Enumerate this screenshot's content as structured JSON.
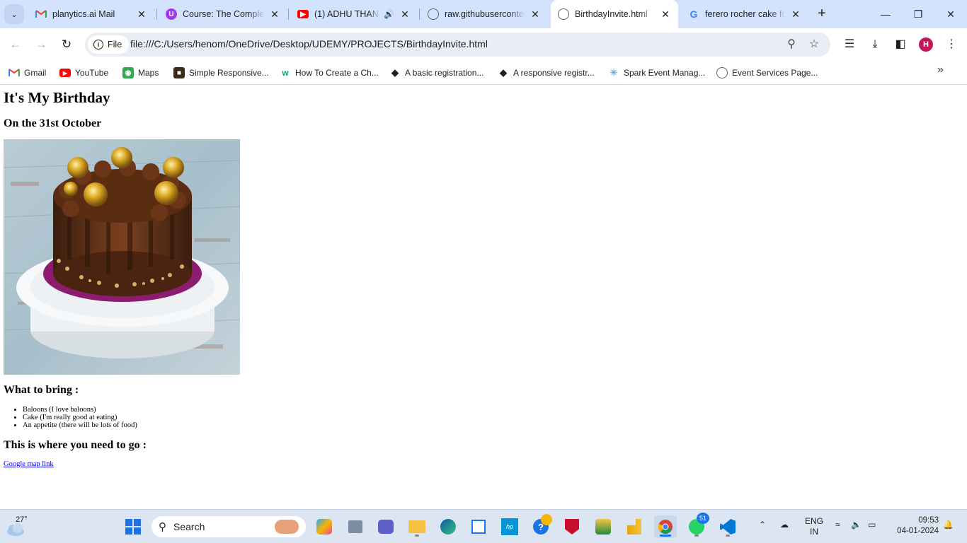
{
  "browser": {
    "tabs": [
      {
        "title": "planytics.ai Mail",
        "icon": "gmail-icon",
        "color": "#ea4335"
      },
      {
        "title": "Course: The Complete",
        "icon": "udemy-icon",
        "color": "#a435f0"
      },
      {
        "title": "(1) ADHU THAN K",
        "icon": "youtube-icon",
        "color": "#ff0000"
      },
      {
        "title": "raw.githubuserconten",
        "icon": "globe-icon",
        "color": "#5f6368"
      },
      {
        "title": "BirthdayInvite.html",
        "icon": "globe-icon",
        "color": "#5f6368"
      },
      {
        "title": "ferero rocher cake fo",
        "icon": "google-icon",
        "color": "#4285f4"
      }
    ],
    "active_tab_index": 4,
    "address": {
      "chip_label": "File",
      "url": "file:///C:/Users/henom/OneDrive/Desktop/UDEMY/PROJECTS/BirthdayInvite.html"
    },
    "profile_initial": "H",
    "bookmarks": [
      {
        "label": "Gmail",
        "icon": "gmail-icon"
      },
      {
        "label": "YouTube",
        "icon": "youtube-icon"
      },
      {
        "label": "Maps",
        "icon": "maps-icon"
      },
      {
        "label": "Simple Responsive...",
        "icon": "site-icon"
      },
      {
        "label": "How To Create a Ch...",
        "icon": "w3schools-icon"
      },
      {
        "label": "A basic registration...",
        "icon": "codepen-icon"
      },
      {
        "label": "A responsive registr...",
        "icon": "codepen-icon"
      },
      {
        "label": "Spark Event Manag...",
        "icon": "spark-icon"
      },
      {
        "label": "Event Services Page...",
        "icon": "globe-icon"
      }
    ]
  },
  "page": {
    "title": "It's My Birthday",
    "date": "On the 31st October",
    "bring_heading": "What to bring :",
    "bring_items": [
      "Baloons (I love baloons)",
      "Cake (I'm really good at eating)",
      "An appetite (there will be lots of food)"
    ],
    "go_heading": "This is where you need to go :",
    "map_link": "Google map link"
  },
  "taskbar": {
    "weather_temp": "27°",
    "search_placeholder": "Search",
    "whatsapp_badge": "51",
    "language": "ENG",
    "region": "IN",
    "time": "09:53",
    "date": "04-01-2024"
  }
}
